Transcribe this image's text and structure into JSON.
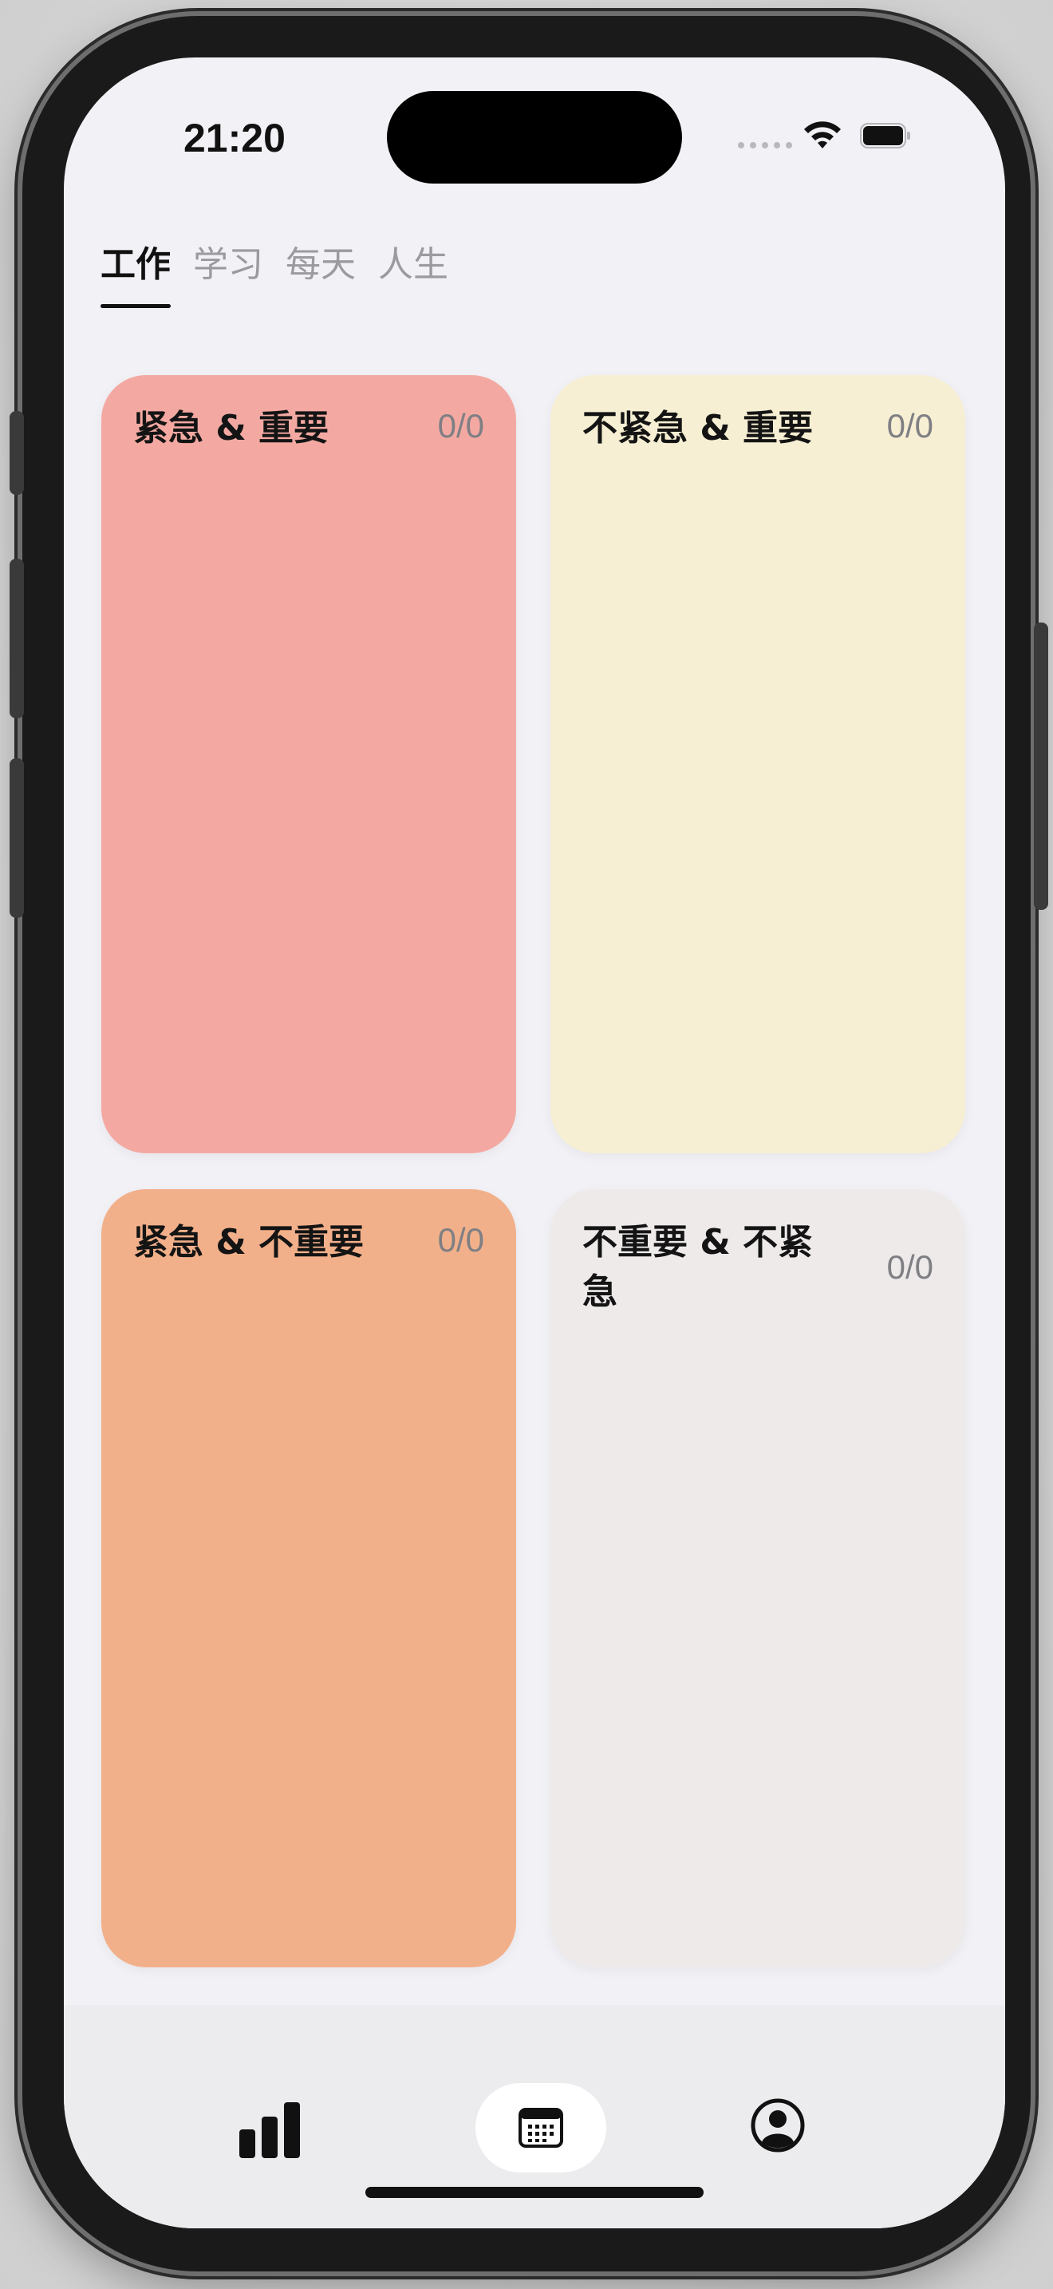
{
  "status_bar": {
    "time": "21:20"
  },
  "tabs": [
    {
      "label": "工作",
      "active": true
    },
    {
      "label": "学习",
      "active": false
    },
    {
      "label": "每天",
      "active": false
    },
    {
      "label": "人生",
      "active": false
    }
  ],
  "quadrants": [
    {
      "title": "紧急 & 重要",
      "count": "0/0",
      "color": "#f3a9a2"
    },
    {
      "title": "不紧急 & 重要",
      "count": "0/0",
      "color": "#f7efd3"
    },
    {
      "title": "紧急 & 不重要",
      "count": "0/0",
      "color": "#f2b08a"
    },
    {
      "title": "不重要 & 不紧急",
      "count": "0/0",
      "color": "#eeeaea"
    }
  ],
  "tabbar": {
    "items": [
      {
        "icon": "bar-chart-icon"
      },
      {
        "icon": "calendar-icon",
        "selected": true
      },
      {
        "icon": "profile-icon"
      }
    ]
  }
}
